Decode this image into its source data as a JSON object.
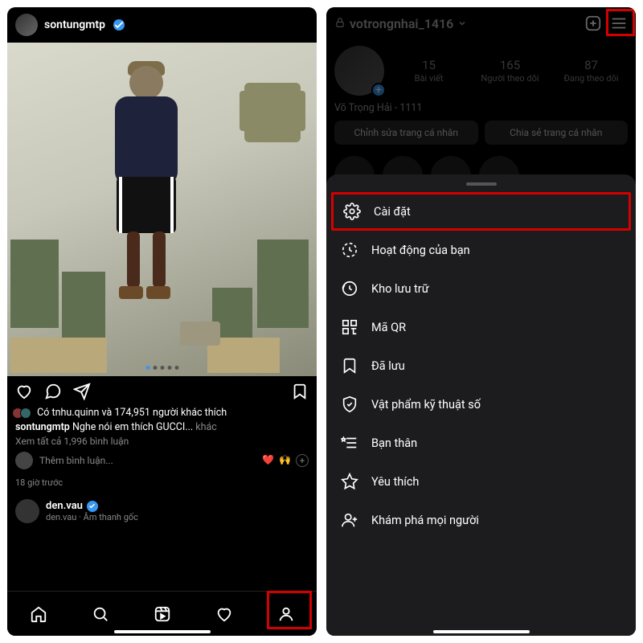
{
  "left": {
    "post_username": "sontungmtp",
    "likes_text": "Có tnhu.quinn và 174,951 người khác thích",
    "caption_user": "sontungmtp",
    "caption_text": "Nghe nói em thích GUCCI...",
    "caption_more": "khác",
    "view_comments": "Xem tất cả 1,996 bình luận",
    "add_comment_placeholder": "Thêm bình luận...",
    "emoji1": "❤️",
    "emoji2": "🙌",
    "time_ago": "18 giờ trước",
    "reel_user": "den.vau",
    "reel_sub": "den.vau · Âm thanh gốc"
  },
  "right": {
    "username": "votrongnhai_1416",
    "nametext": "Võ Trọng Hải - 1111",
    "stats": {
      "posts_num": "15",
      "posts_lbl": "Bài viết",
      "followers_num": "165",
      "followers_lbl": "Người theo dõi",
      "following_num": "87",
      "following_lbl": "Đang theo dõi"
    },
    "btn_edit": "Chỉnh sửa trang cá nhân",
    "btn_share": "Chia sẻ trang cá nhân",
    "menu": {
      "settings": "Cài đặt",
      "activity": "Hoạt động của bạn",
      "archive": "Kho lưu trữ",
      "qr": "Mã QR",
      "saved": "Đã lưu",
      "digital": "Vật phẩm kỹ thuật số",
      "close": "Bạn thân",
      "fav": "Yêu thích",
      "discover": "Khám phá mọi người"
    }
  }
}
